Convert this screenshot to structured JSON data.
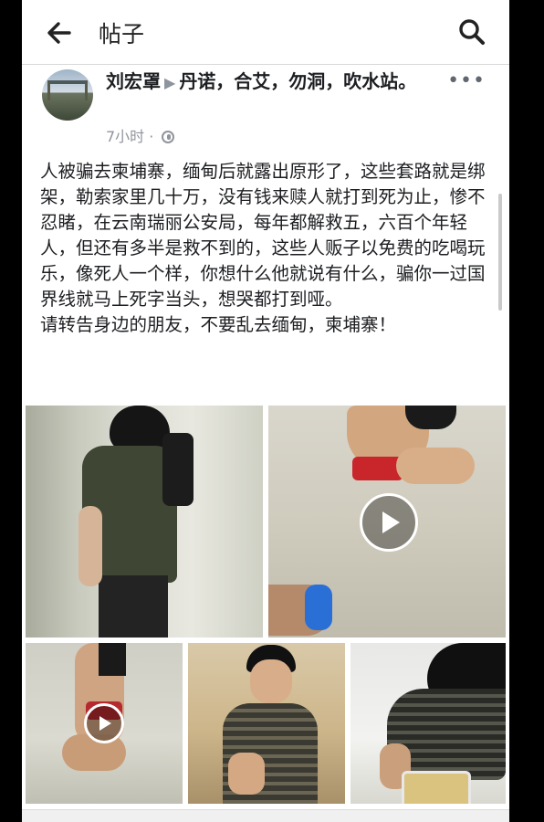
{
  "header": {
    "title": "帖子"
  },
  "post": {
    "author": "刘宏罩",
    "location": "丹诺，合艾，勿洞，吹水站。",
    "time": "7小时",
    "text": "人被骗去柬埔寨，缅甸后就露出原形了，这些套路就是绑架，勒索家里几十万，没有钱来赎人就打到死为止，惨不忍睹，在云南瑞丽公安局，每年都解救五，六百个年轻人，但还有多半是救不到的，这些人贩子以免费的吃喝玩乐，像死人一个样，你想什么他就说有什么，骗你一过国界线就马上死字当头，想哭都打到哑。\n请转告身边的朋友，不要乱去缅甸，柬埔寨！"
  },
  "icons": {
    "back": "arrow-left-icon",
    "search": "search-icon",
    "more": "more-options-icon",
    "audience": "globe-icon",
    "play": "play-icon"
  },
  "colors": {
    "text": "#1c1e21",
    "meta": "#90949c",
    "background": "#ffffff"
  }
}
